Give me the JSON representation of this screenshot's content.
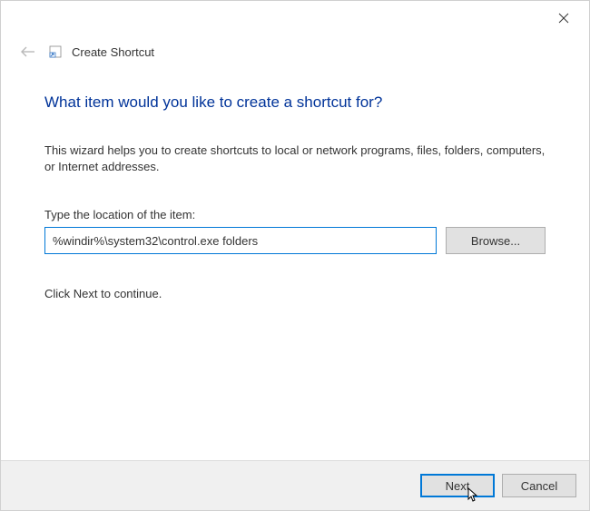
{
  "header": {
    "title": "Create Shortcut"
  },
  "content": {
    "heading": "What item would you like to create a shortcut for?",
    "description": "This wizard helps you to create shortcuts to local or network programs, files, folders, computers, or Internet addresses.",
    "location_label": "Type the location of the item:",
    "location_value": "%windir%\\system32\\control.exe folders",
    "browse_label": "Browse...",
    "continue_text": "Click Next to continue."
  },
  "footer": {
    "next_label": "Next",
    "cancel_label": "Cancel"
  }
}
